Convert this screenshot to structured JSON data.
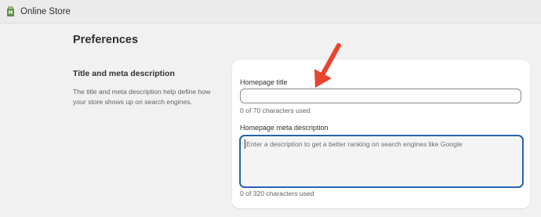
{
  "topbar": {
    "app_name": "Online Store",
    "logo_icon": "shopify-bag-icon",
    "brand_color": "#5e8e3e"
  },
  "page": {
    "title": "Preferences"
  },
  "section": {
    "title": "Title and meta description",
    "description": "The title and meta description help define how your store shows up on search engines."
  },
  "form": {
    "homepage_title": {
      "label": "Homepage title",
      "value": "",
      "helper": "0 of 70 characters used"
    },
    "meta_description": {
      "label": "Homepage meta description",
      "placeholder": "Enter a description to get a better ranking on search engines like Google",
      "value": "",
      "helper": "0 of 320 characters used"
    }
  },
  "annotation": {
    "icon": "red-arrow-icon",
    "color": "#e8432f"
  },
  "colors": {
    "focus_border": "#0a4f94",
    "page_background": "#f1f1f1"
  }
}
